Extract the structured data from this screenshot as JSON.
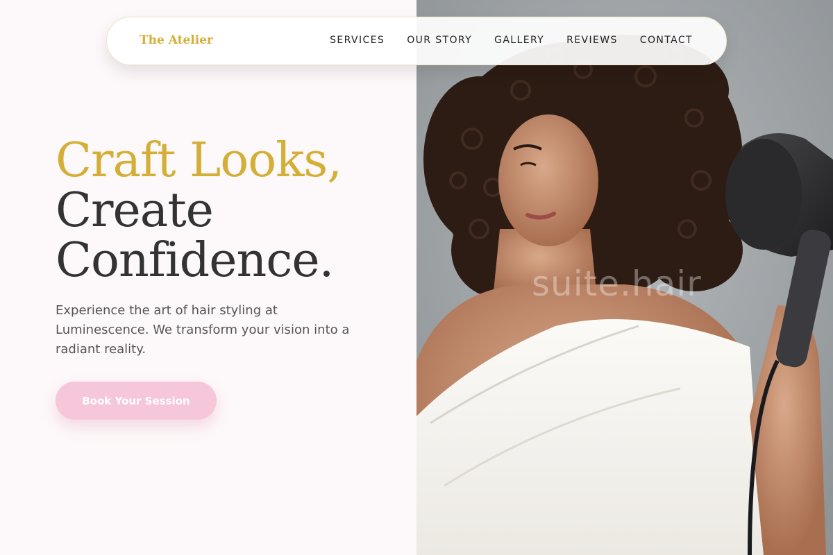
{
  "nav": {
    "brand": "The Atelier",
    "links": [
      "SERVICES",
      "OUR STORY",
      "GALLERY",
      "REVIEWS",
      "CONTACT"
    ]
  },
  "hero": {
    "headline_line1": "Craft Looks,",
    "headline_line2": "Create",
    "headline_line3": "Confidence.",
    "subcopy": "Experience the art of hair styling at Luminescence. We transform your vision into a radiant reality.",
    "cta_label": "Book Your Session"
  },
  "photo": {
    "watermark": "suite.hair"
  },
  "colors": {
    "accent_gold": "#d4af37",
    "cta_pink": "#f6c6db",
    "background": "#fdf8f9",
    "text_dark": "#333333"
  }
}
